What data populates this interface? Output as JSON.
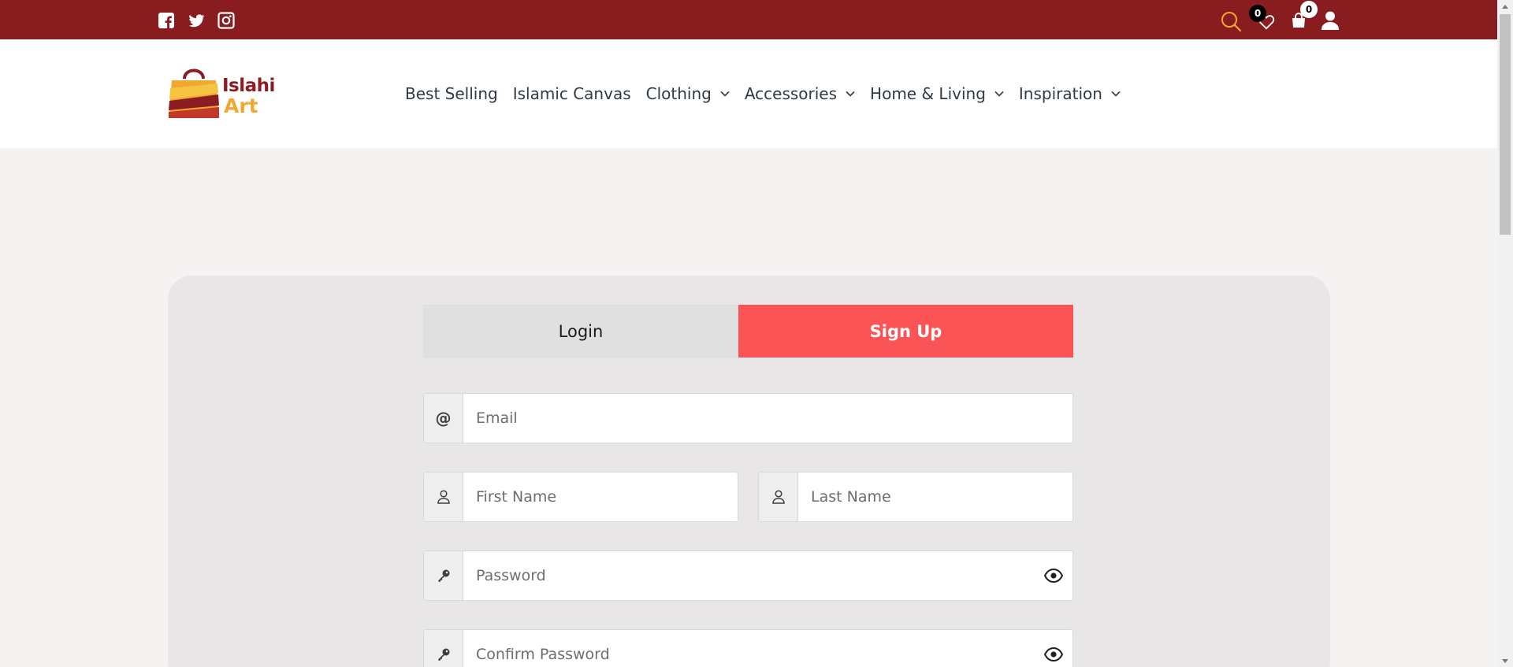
{
  "brand": {
    "logo_line1": "Islahi",
    "logo_line2": "Art"
  },
  "colors": {
    "topbar": "#891c1e",
    "accent": "#fb5456",
    "search_icon": "#f0a830"
  },
  "topbar": {
    "social": [
      "facebook-icon",
      "twitter-icon",
      "instagram-icon"
    ],
    "wishlist_count": "0",
    "cart_count": "0"
  },
  "nav": {
    "items": [
      {
        "label": "Best Selling",
        "dropdown": false
      },
      {
        "label": "Islamic Canvas",
        "dropdown": false
      },
      {
        "label": "Clothing",
        "dropdown": true
      },
      {
        "label": "Accessories",
        "dropdown": true
      },
      {
        "label": "Home & Living",
        "dropdown": true
      },
      {
        "label": "Inspiration",
        "dropdown": true
      }
    ]
  },
  "auth": {
    "tabs": {
      "login": "Login",
      "signup": "Sign Up",
      "active": "signup"
    },
    "fields": {
      "email": {
        "placeholder": "Email",
        "addon": "@"
      },
      "first_name": {
        "placeholder": "First Name"
      },
      "last_name": {
        "placeholder": "Last Name"
      },
      "password": {
        "placeholder": "Password"
      },
      "confirm_password": {
        "placeholder": "Confirm Password"
      }
    }
  }
}
